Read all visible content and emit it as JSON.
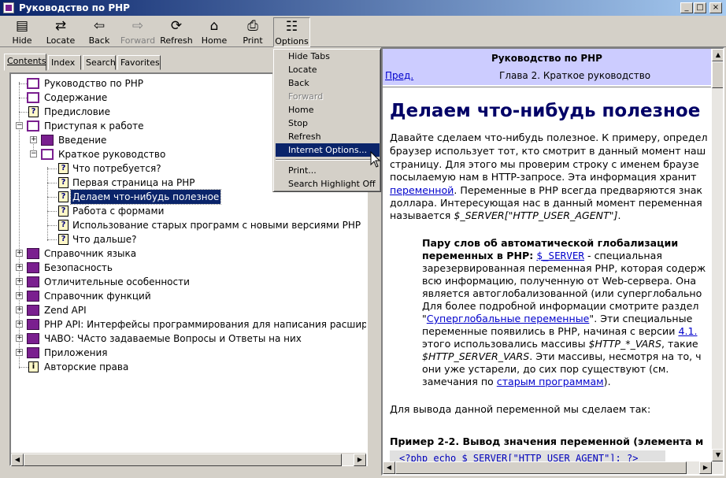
{
  "window": {
    "title": "Руководство по PHP",
    "buttons": [
      "_",
      "□",
      "×"
    ]
  },
  "toolbar": {
    "buttons": [
      {
        "label": "Hide",
        "icon": "hide-icon",
        "glyph": "▤"
      },
      {
        "label": "Locate",
        "icon": "locate-icon",
        "glyph": "⇄"
      },
      {
        "label": "Back",
        "icon": "back-arrow-icon",
        "glyph": "⇦"
      },
      {
        "label": "Forward",
        "icon": "forward-arrow-icon",
        "glyph": "⇨"
      },
      {
        "label": "Refresh",
        "icon": "refresh-icon",
        "glyph": "⟳"
      },
      {
        "label": "Home",
        "icon": "home-icon",
        "glyph": "⌂"
      },
      {
        "label": "Print",
        "icon": "print-icon",
        "glyph": "⎙"
      },
      {
        "label": "Options",
        "icon": "options-icon",
        "glyph": "☷"
      }
    ]
  },
  "tabs": {
    "contents": "Contents",
    "index": "Index",
    "search": "Search",
    "favorites": "Favorites"
  },
  "tree": {
    "items": [
      {
        "label": "Руководство по PHP",
        "icon": "book-open-icon"
      },
      {
        "label": "Содержание",
        "icon": "book-open-icon"
      },
      {
        "label": "Предисловие",
        "icon": "help-page-icon"
      },
      {
        "label": "Приступая к работе",
        "icon": "book-open-icon"
      },
      {
        "label": "Введение",
        "icon": "book-closed-icon"
      },
      {
        "label": "Краткое руководство",
        "icon": "book-open-icon"
      },
      {
        "label": "Что потребуется?",
        "icon": "help-page-icon"
      },
      {
        "label": "Первая страница на PHP",
        "icon": "help-page-icon"
      },
      {
        "label": "Делаем что-нибудь полезное",
        "icon": "help-page-icon"
      },
      {
        "label": "Работа с формами",
        "icon": "help-page-icon"
      },
      {
        "label": "Использование старых программ с новыми версиями PHP",
        "icon": "help-page-icon"
      },
      {
        "label": "Что дальше?",
        "icon": "help-page-icon"
      },
      {
        "label": "Справочник языка",
        "icon": "book-closed-icon"
      },
      {
        "label": "Безопасность",
        "icon": "book-closed-icon"
      },
      {
        "label": "Отличительные особенности",
        "icon": "book-closed-icon"
      },
      {
        "label": "Справочник функций",
        "icon": "book-closed-icon"
      },
      {
        "label": "Zend API",
        "icon": "book-closed-icon"
      },
      {
        "label": "PHP API: Интерфейсы программирования для написания расширени",
        "icon": "book-closed-icon"
      },
      {
        "label": "ЧАВО: ЧАсто задаваемые Вопросы и Ответы на них",
        "icon": "book-closed-icon"
      },
      {
        "label": "Приложения",
        "icon": "book-closed-icon"
      },
      {
        "label": "Авторские права",
        "icon": "info-page-icon"
      }
    ],
    "selected": "Делаем что-нибудь полезное"
  },
  "menu": {
    "items": [
      {
        "label": "Hide Tabs"
      },
      {
        "label": "Locate"
      },
      {
        "label": "Back"
      },
      {
        "label": "Forward",
        "disabled": true
      },
      {
        "label": "Home"
      },
      {
        "label": "Stop"
      },
      {
        "label": "Refresh"
      },
      {
        "label": "Internet Options...",
        "highlighted": true
      },
      {
        "label": "Print..."
      },
      {
        "label": "Search Highlight Off"
      }
    ]
  },
  "content": {
    "nav_title": "Руководство по PHP",
    "prev": "Пред.",
    "chapter": "Глава 2. Краткое руководство",
    "heading": "Делаем что-нибудь полезное",
    "p1": [
      "Давайте сделаем что-нибудь полезное. К примеру, определ",
      "браузер использует тот, кто смотрит в данный момент наш",
      "страницу. Для этого мы проверим строку с именем браузе",
      "посылаемую нам в HTTP-запросе. Эта информация хранит"
    ],
    "p1_link": "переменной",
    "p1_after_link": ". Переменные в PHP всегда предваряются знак",
    "p1_l6": "доллара. Интересующая нас в данный момент переменная",
    "p1_l7_pre": "называется ",
    "p1_l7_var": "$_SERVER[\"HTTP_USER_AGENT\"]",
    "p1_l7_post": ".",
    "note_bold1": "Пару слов об автоматической глобализации",
    "note_bold2": "переменных в PHP:",
    "note_link1": "$_SERVER",
    "note_l2_post": " - специальная",
    "note_l3": "зарезервированная переменная PHP, которая содерж",
    "note_l4": "всю информацию, полученную от Web-сервера. Она",
    "note_l5": "является автоглобализованной (или суперглобально",
    "note_l6": "Для более подробной информации смотрите раздел",
    "note_l7_q1": "\"",
    "note_link2": "Суперглобальные переменные",
    "note_l7_post": "\". Эти специальные",
    "note_l8_pre": "переменные появились в PHP, начиная с версии ",
    "note_link3": "4.1.",
    "note_l9_pre": "этого использовались массивы ",
    "note_l9_var": "$HTTP_*_VARS",
    "note_l9_post": ", такие",
    "note_l10_var": "$HTTP_SERVER_VARS",
    "note_l10_post": ". Эти массивы, несмотря на то, ч",
    "note_l11": "они уже устарели, до сих пор существуют (см.",
    "note_l12_pre": "замечания по ",
    "note_link4": "старым программам",
    "note_l12_post": ").",
    "p2": "Для вывода данной переменной мы сделаем так:",
    "example_title": "Пример 2-2. Вывод значения переменной (элемента м",
    "code": "<?php echo $_SERVER[\"HTTP_USER_AGENT\"]; ?>"
  }
}
